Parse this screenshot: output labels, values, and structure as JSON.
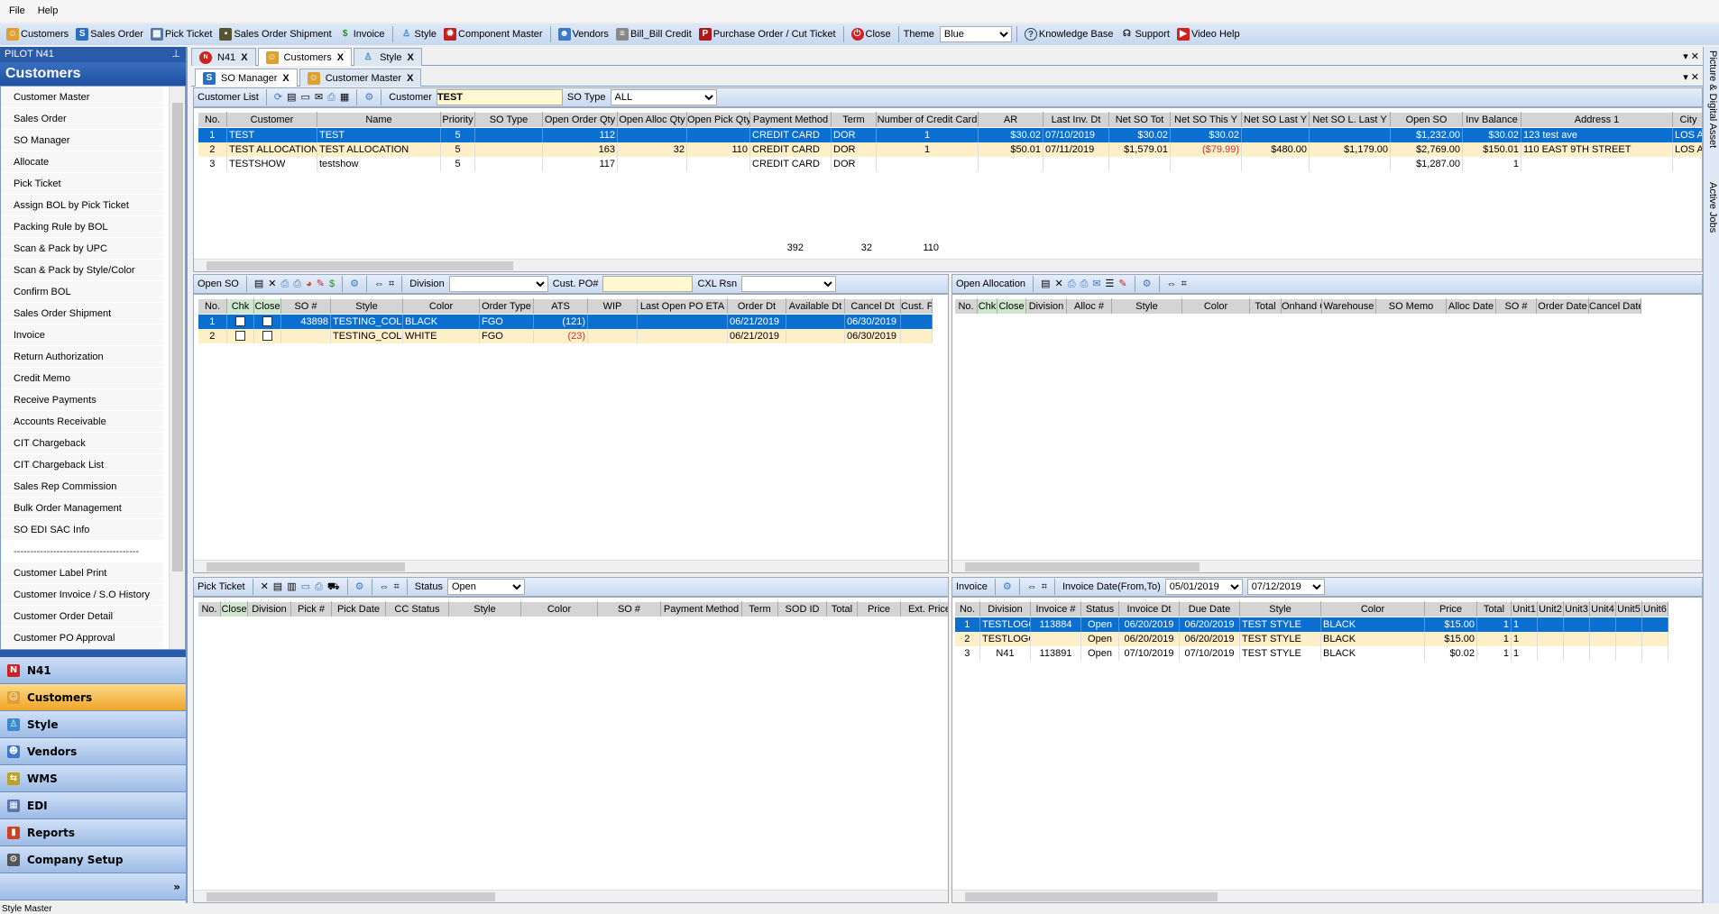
{
  "menu": {
    "file": "File",
    "help": "Help"
  },
  "toolbar": {
    "items": [
      "Customers",
      "Sales Order",
      "Pick Ticket",
      "Sales Order Shipment",
      "Invoice",
      "Style",
      "Component Master",
      "Vendors",
      "Bill_Bill Credit",
      "Purchase Order / Cut Ticket",
      "Close"
    ],
    "theme_label": "Theme",
    "theme_value": "Blue",
    "knowledge_base": "Knowledge Base",
    "support": "Support",
    "video_help": "Video Help"
  },
  "sidebar": {
    "title": "PILOT N41",
    "heading": "Customers",
    "items": [
      "Customer Master",
      "Sales Order",
      "SO Manager",
      "Allocate",
      "Pick Ticket",
      "Assign BOL by Pick Ticket",
      "Packing Rule by BOL",
      "Scan & Pack by UPC",
      "Scan & Pack by Style/Color",
      "Confirm BOL",
      "Sales Order Shipment",
      "Invoice",
      "Return Authorization",
      "Credit Memo",
      "Receive Payments",
      "Accounts Receivable",
      "CIT Chargeback",
      "CIT Chargeback List",
      "Sales Rep Commission",
      "Bulk Order Management",
      "SO EDI SAC Info"
    ],
    "separator": "--------------------------------------",
    "items2": [
      "Customer Label Print",
      "Customer Invoice / S.O History",
      "Customer Order Detail",
      "Customer PO Approval"
    ],
    "nav": [
      "N41",
      "Customers",
      "Style",
      "Vendors",
      "WMS",
      "EDI",
      "Reports",
      "Company Setup"
    ],
    "active_nav": "Customers"
  },
  "tabs": [
    "N41",
    "Customers",
    "Style"
  ],
  "subtabs": [
    "SO Manager",
    "Customer Master"
  ],
  "side_strip": {
    "picture": "Picture & Digital Asset",
    "jobs": "Active Jobs"
  },
  "customer_list": {
    "label": "Customer List",
    "customer_label": "Customer",
    "customer_value": "TEST",
    "so_type_label": "SO Type",
    "so_type_value": "ALL",
    "columns": [
      "No.",
      "Customer",
      "Name",
      "Priority",
      "SO Type",
      "Open Order Qty",
      "Open Alloc Qty",
      "Open Pick Qty",
      "Payment Method",
      "Term",
      "Number of Credit Card",
      "AR",
      "Last Inv. Dt",
      "Net SO Tot",
      "Net SO This Y",
      "Net SO Last Y",
      "Net SO L. Last Y",
      "Open SO",
      "Inv Balance",
      "Address 1",
      "City"
    ],
    "rows": [
      [
        "1",
        "TEST",
        "TEST",
        "5",
        "",
        "112",
        "",
        "",
        "CREDIT CARD",
        "DOR",
        "1",
        "$30.02",
        "07/10/2019",
        "$30.02",
        "$30.02",
        "",
        "",
        "$1,232.00",
        "$30.02",
        "123 test ave",
        "LOS AN"
      ],
      [
        "2",
        "TEST ALLOCATION",
        "TEST ALLOCATION",
        "5",
        "",
        "163",
        "32",
        "110",
        "CREDIT CARD",
        "DOR",
        "1",
        "$50.01",
        "07/11/2019",
        "$1,579.01",
        "($79.99)",
        "$480.00",
        "$1,179.00",
        "$2,769.00",
        "$150.01",
        "110 EAST 9TH STREET",
        "LOS AN"
      ],
      [
        "3",
        "TESTSHOW",
        "testshow",
        "5",
        "",
        "117",
        "",
        "",
        "CREDIT CARD",
        "DOR",
        "",
        "",
        "",
        "",
        "",
        "",
        "",
        "$1,287.00",
        "1",
        "",
        ""
      ]
    ],
    "totals": {
      "open_order_qty": "392",
      "open_alloc_qty": "32",
      "open_pick_qty": "110"
    }
  },
  "open_so": {
    "label": "Open SO",
    "division_label": "Division",
    "division_value": "",
    "cust_po_label": "Cust. PO#",
    "cust_po_value": "",
    "cxl_label": "CXL Rsn",
    "cxl_value": "",
    "columns": [
      "No.",
      "Chk",
      "Close",
      "SO #",
      "Style",
      "Color",
      "Order Type",
      "ATS",
      "WIP",
      "Last Open PO ETA",
      "Order Dt",
      "Available Dt",
      "Cancel Dt",
      "Cust. PO"
    ],
    "rows": [
      [
        "1",
        "",
        "",
        "43898",
        "TESTING_COLOR",
        "BLACK",
        "FGO",
        "(121)",
        "",
        "",
        "06/21/2019",
        "",
        "06/30/2019",
        ""
      ],
      [
        "2",
        "",
        "",
        "",
        "TESTING_COLOR",
        "WHITE",
        "FGO",
        "(23)",
        "",
        "",
        "06/21/2019",
        "",
        "06/30/2019",
        ""
      ]
    ]
  },
  "open_allocation": {
    "label": "Open Allocation",
    "columns": [
      "No.",
      "Chk",
      "Close",
      "Division",
      "Alloc #",
      "Style",
      "Color",
      "Total",
      "Onhand Q",
      "Warehouse",
      "SO Memo",
      "Alloc Date",
      "SO #",
      "Order Date",
      "Cancel Date"
    ]
  },
  "pick_ticket": {
    "label": "Pick Ticket",
    "status_label": "Status",
    "status_value": "Open",
    "columns": [
      "No.",
      "Close",
      "Division",
      "Pick #",
      "Pick Date",
      "CC Status",
      "Style",
      "Color",
      "SO #",
      "Payment Method",
      "Term",
      "SOD ID",
      "Total",
      "Price",
      "Ext. Price"
    ]
  },
  "invoice": {
    "label": "Invoice",
    "date_label": "Invoice Date(From,To)",
    "date_from": "05/01/2019",
    "date_to": "07/12/2019",
    "columns": [
      "No.",
      "Division",
      "Invoice #",
      "Status",
      "Invoice Dt",
      "Due Date",
      "Style",
      "Color",
      "Price",
      "Total",
      "Unit1",
      "Unit2",
      "Unit3",
      "Unit4",
      "Unit5",
      "Unit6"
    ],
    "rows": [
      [
        "1",
        "TESTLOGO",
        "113884",
        "Open",
        "06/20/2019",
        "06/20/2019",
        "TEST STYLE",
        "BLACK",
        "$15.00",
        "1",
        "1",
        "",
        "",
        "",
        "",
        ""
      ],
      [
        "2",
        "TESTLOGO",
        "",
        "Open",
        "06/20/2019",
        "06/20/2019",
        "TEST STYLE",
        "BLACK",
        "$15.00",
        "1",
        "1",
        "",
        "",
        "",
        "",
        ""
      ],
      [
        "3",
        "N41",
        "113891",
        "Open",
        "07/10/2019",
        "07/10/2019",
        "TEST STYLE",
        "BLACK",
        "$0.02",
        "1",
        "1",
        "",
        "",
        "",
        "",
        ""
      ]
    ]
  },
  "status_bar": "Style Master",
  "colors": {
    "selected_row": "#0a6fd1",
    "alt_row": "#fdefc8",
    "accent": "#2a5ba8",
    "active_nav": "#f0a626",
    "negative": "#d03030"
  }
}
